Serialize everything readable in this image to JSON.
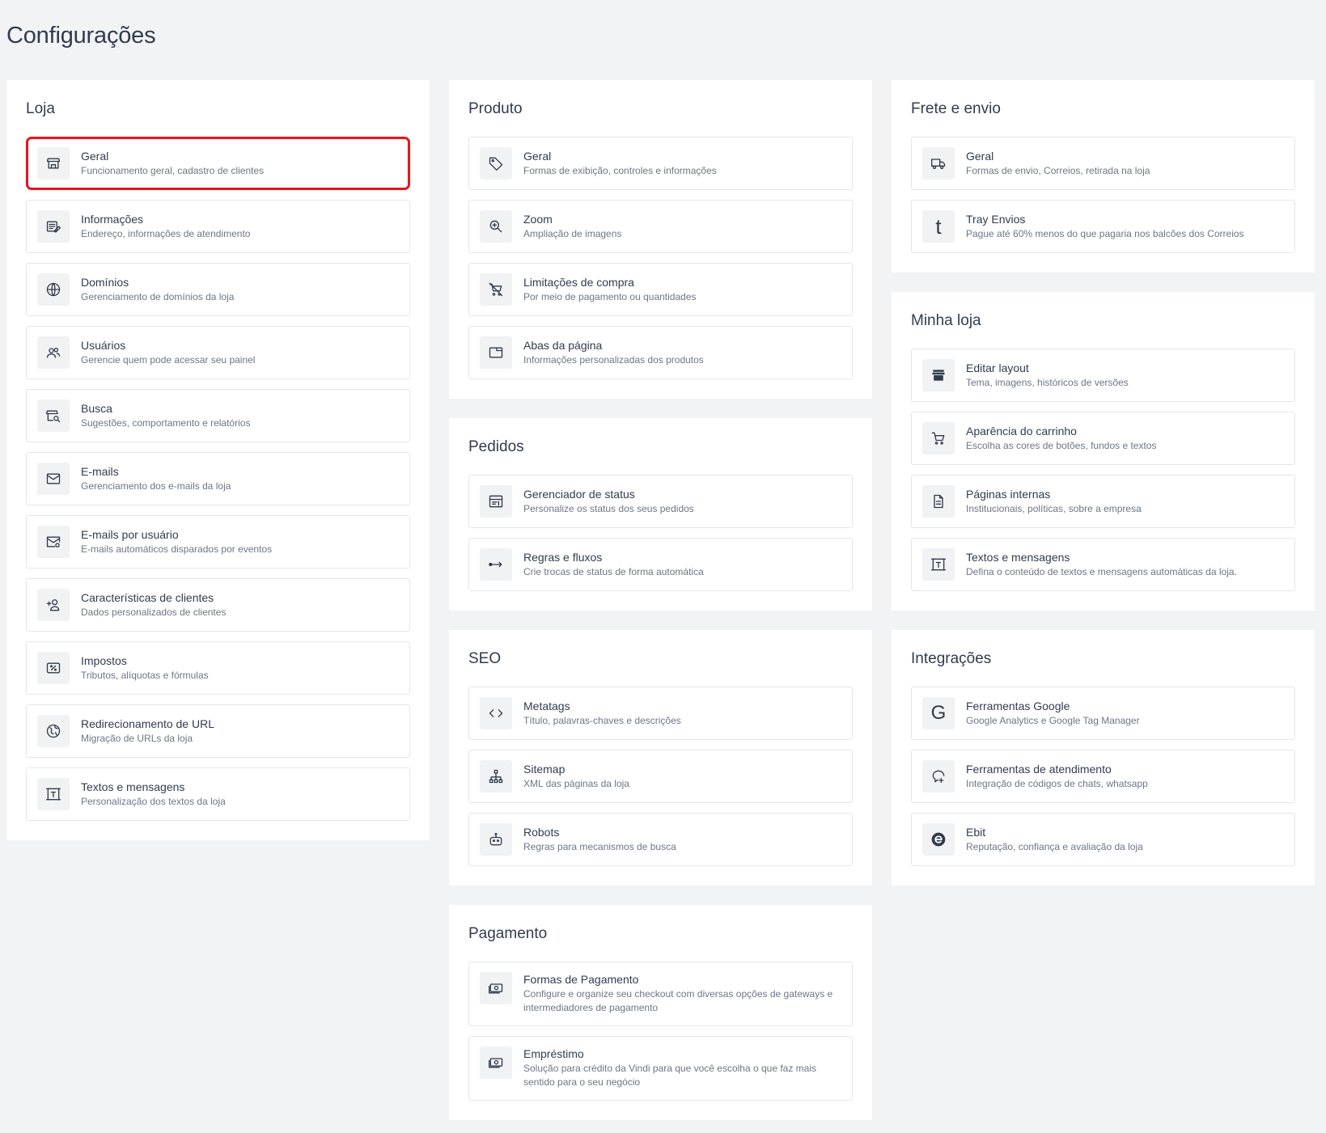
{
  "page": {
    "title": "Configurações",
    "highlight_color": "#e8141b"
  },
  "sections": {
    "loja": {
      "title": "Loja",
      "items": [
        {
          "label": "Geral",
          "desc": "Funcionamento geral, cadastro de clientes",
          "icon": "store-icon"
        },
        {
          "label": "Informações",
          "desc": "Endereço, informações de atendimento",
          "icon": "edit-info-icon"
        },
        {
          "label": "Domínios",
          "desc": "Gerenciamento de domínios da loja",
          "icon": "globe-icon"
        },
        {
          "label": "Usuários",
          "desc": "Gerencie quem pode acessar seu painel",
          "icon": "users-icon"
        },
        {
          "label": "Busca",
          "desc": "Sugestões, comportamento e relatórios",
          "icon": "search-store-icon"
        },
        {
          "label": "E-mails",
          "desc": "Gerenciamento dos e-mails da loja",
          "icon": "mail-icon"
        },
        {
          "label": "E-mails por usuário",
          "desc": "E-mails automáticos disparados por eventos",
          "icon": "mail-settings-icon"
        },
        {
          "label": "Características de clientes",
          "desc": "Dados personalizados de clientes",
          "icon": "user-add-icon"
        },
        {
          "label": "Impostos",
          "desc": "Tributos, alíquotas e fórmulas",
          "icon": "tax-icon"
        },
        {
          "label": "Redirecionamento de URL",
          "desc": "Migração de URLs da loja",
          "icon": "globe-redirect-icon"
        },
        {
          "label": "Textos e mensagens",
          "desc": "Personalização dos textos da loja",
          "icon": "text-frame-icon"
        }
      ]
    },
    "produto": {
      "title": "Produto",
      "items": [
        {
          "label": "Geral",
          "desc": "Formas de exibição, controles e informações",
          "icon": "tag-icon"
        },
        {
          "label": "Zoom",
          "desc": "Ampliação de imagens",
          "icon": "zoom-icon"
        },
        {
          "label": "Limitações de compra",
          "desc": "Por meio de pagamento ou quantidades",
          "icon": "cart-off-icon"
        },
        {
          "label": "Abas da página",
          "desc": "Informações personalizadas dos produtos",
          "icon": "tab-icon"
        }
      ]
    },
    "pedidos": {
      "title": "Pedidos",
      "items": [
        {
          "label": "Gerenciador de status",
          "desc": "Personalize os status dos seus pedidos",
          "icon": "status-icon"
        },
        {
          "label": "Regras e fluxos",
          "desc": "Crie trocas de status de forma automática",
          "icon": "flow-icon"
        }
      ]
    },
    "seo": {
      "title": "SEO",
      "items": [
        {
          "label": "Metatags",
          "desc": "Título, palavras-chaves e descrições",
          "icon": "code-icon"
        },
        {
          "label": "Sitemap",
          "desc": "XML das páginas da loja",
          "icon": "sitemap-icon"
        },
        {
          "label": "Robots",
          "desc": "Regras para mecanismos de busca",
          "icon": "robot-icon"
        }
      ]
    },
    "pagamento": {
      "title": "Pagamento",
      "items": [
        {
          "label": "Formas de Pagamento",
          "desc": "Configure e organize seu checkout com diversas opções de gateways e intermediadores de pagamento",
          "icon": "money-icon"
        },
        {
          "label": "Empréstimo",
          "desc": "Solução para crédito da Vindi para que você escolha o que faz mais sentido para o seu negócio",
          "icon": "money-icon"
        }
      ]
    },
    "frete": {
      "title": "Frete e envio",
      "items": [
        {
          "label": "Geral",
          "desc": "Formas de envio, Correios, retirada na loja",
          "icon": "truck-icon"
        },
        {
          "label": "Tray Envios",
          "desc": "Pague até 60% menos do que pagaria nos balcões dos Correios",
          "icon": "tray-logo-icon",
          "glyph": "t"
        }
      ]
    },
    "minha_loja": {
      "title": "Minha loja",
      "items": [
        {
          "label": "Editar layout",
          "desc": "Tema, imagens, históricos de versões",
          "icon": "storefront-icon"
        },
        {
          "label": "Aparência do carrinho",
          "desc": "Escolha as cores de botões, fundos e textos",
          "icon": "cart-icon"
        },
        {
          "label": "Páginas internas",
          "desc": "Institucionais, políticas, sobre a empresa",
          "icon": "document-icon"
        },
        {
          "label": "Textos e mensagens",
          "desc": "Defina o conteúdo de textos e mensagens automáticas da loja.",
          "icon": "text-frame-icon"
        }
      ]
    },
    "integracoes": {
      "title": "Integrações",
      "items": [
        {
          "label": "Ferramentas Google",
          "desc": "Google Analytics e Google Tag Manager",
          "icon": "google-icon",
          "glyph": "G"
        },
        {
          "label": "Ferramentas de atendimento",
          "desc": "Integração de códigos de chats, whatsapp",
          "icon": "chat-add-icon"
        },
        {
          "label": "Ebit",
          "desc": "Reputação, confiança e avaliação da loja",
          "icon": "ebit-logo-icon"
        }
      ]
    }
  }
}
